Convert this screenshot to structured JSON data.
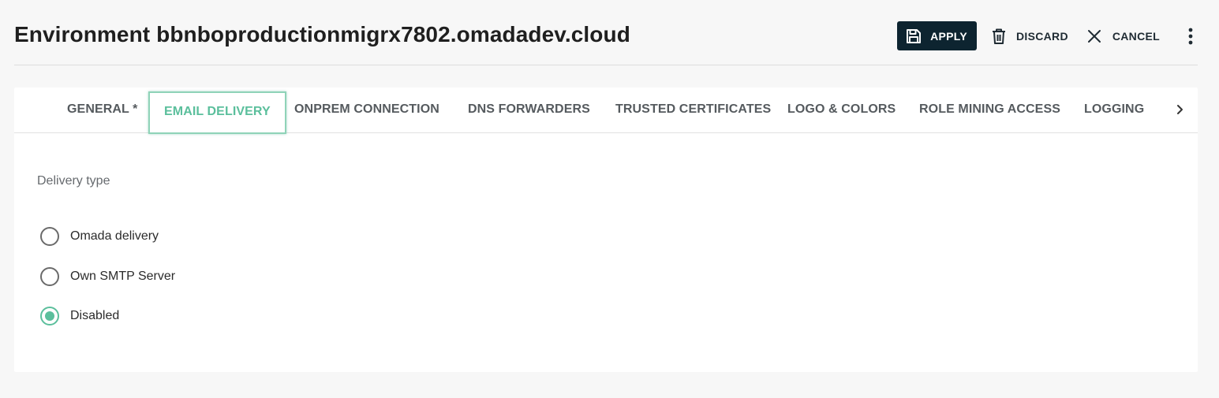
{
  "header": {
    "title": "Environment bbnboproductionmigrx7802.omadadev.cloud"
  },
  "toolbar": {
    "apply_label": "APPLY",
    "discard_label": "DISCARD",
    "cancel_label": "CANCEL",
    "more_icon": "more-vertical-icon"
  },
  "tabs": [
    {
      "label": "GENERAL *",
      "active": false
    },
    {
      "label": "EMAIL DELIVERY",
      "active": true
    },
    {
      "label": "ONPREM CONNECTION",
      "active": false
    },
    {
      "label": "DNS FORWARDERS",
      "active": false
    },
    {
      "label": "TRUSTED CERTIFICATES",
      "active": false
    },
    {
      "label": "LOGO & COLORS",
      "active": false
    },
    {
      "label": "ROLE MINING ACCESS",
      "active": false
    },
    {
      "label": "LOGGING",
      "active": false
    }
  ],
  "email_delivery": {
    "section_label": "Delivery type",
    "options": [
      {
        "label": "Omada delivery",
        "checked": false
      },
      {
        "label": "Own SMTP Server",
        "checked": false
      },
      {
        "label": "Disabled",
        "checked": true
      }
    ]
  },
  "colors": {
    "accent": "#5bbf9c",
    "primary_button": "#0d2430"
  }
}
